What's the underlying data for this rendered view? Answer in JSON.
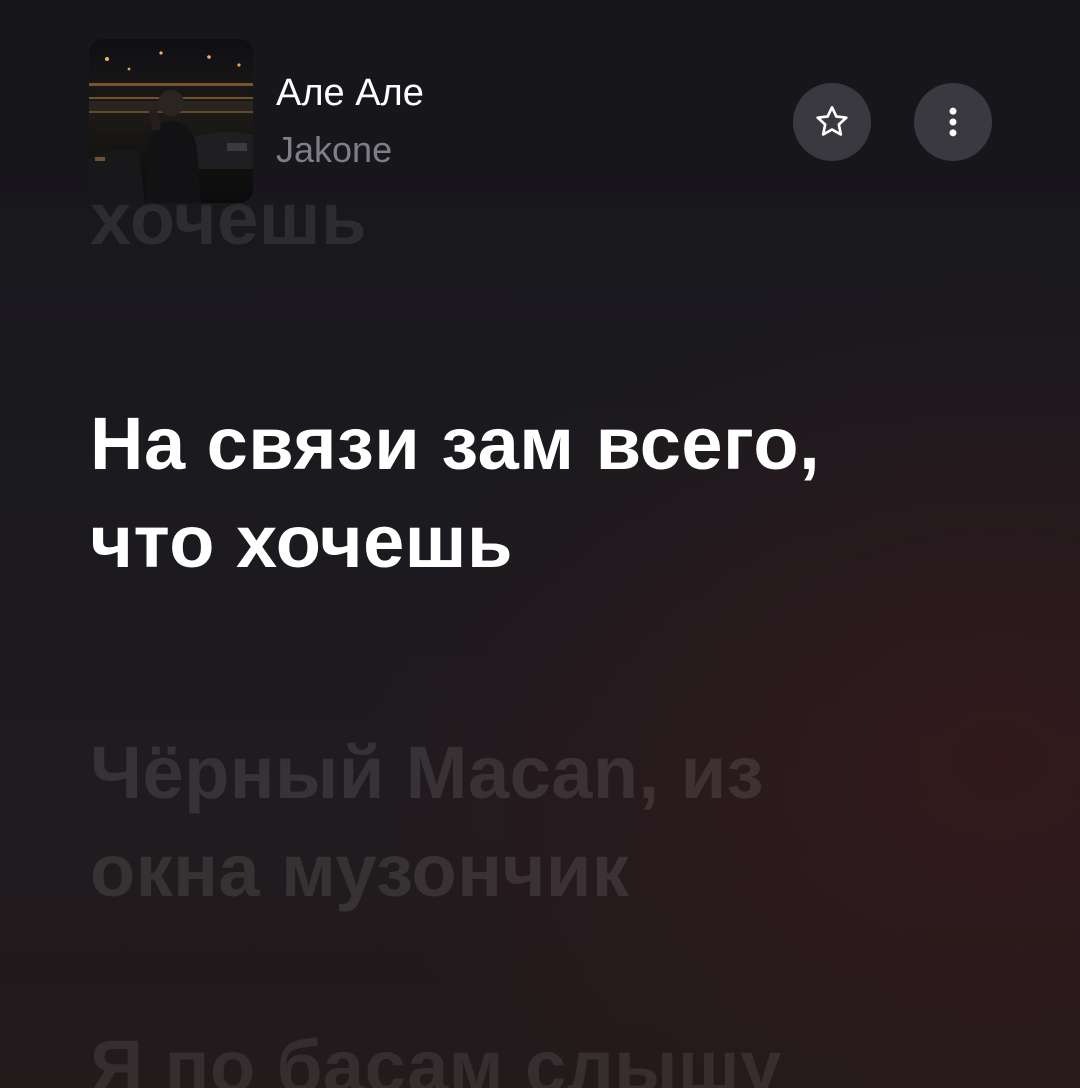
{
  "track": {
    "title": "Але Але",
    "artist": "Jakone"
  },
  "actions": {
    "favorite_icon": "star-outline-icon",
    "more_icon": "vertical-dots-icon"
  },
  "lyrics": {
    "previous_line": "хочешь",
    "current_line": [
      "На связи зам всего,",
      "что хочешь"
    ],
    "next_line": [
      "Чёрный Macan, из",
      "окна музончик"
    ],
    "next_line_2": "Я по басам слышу"
  },
  "colors": {
    "background": "#17161b",
    "accent_text": "#ffffff",
    "artist_text": "#807d88",
    "button_bg": "#3a3940"
  }
}
